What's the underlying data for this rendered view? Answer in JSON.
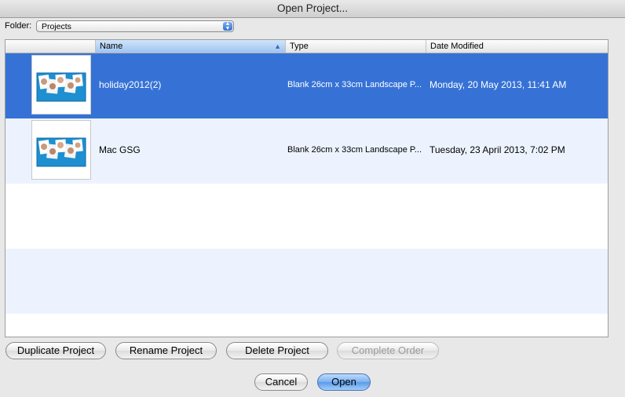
{
  "window": {
    "title": "Open Project..."
  },
  "folder": {
    "label": "Folder:",
    "value": "Projects"
  },
  "columns": {
    "name": "Name",
    "type": "Type",
    "date": "Date Modified"
  },
  "rows": [
    {
      "name": "holiday2012(2)",
      "type": "Blank 26cm x 33cm Landscape P...",
      "date": "Monday, 20 May 2013, 11:41 AM",
      "selected": true
    },
    {
      "name": "Mac GSG",
      "type": "Blank 26cm x 33cm Landscape P...",
      "date": "Tuesday, 23 April 2013, 7:02 PM",
      "selected": false
    }
  ],
  "actions": {
    "duplicate": "Duplicate Project",
    "rename": "Rename Project",
    "delete": "Delete Project",
    "complete": "Complete Order"
  },
  "footer": {
    "cancel": "Cancel",
    "open": "Open"
  },
  "colors": {
    "selection": "#3672d6",
    "alt_row": "#edf3fe",
    "thumb_blue": "#1e8fd1"
  }
}
